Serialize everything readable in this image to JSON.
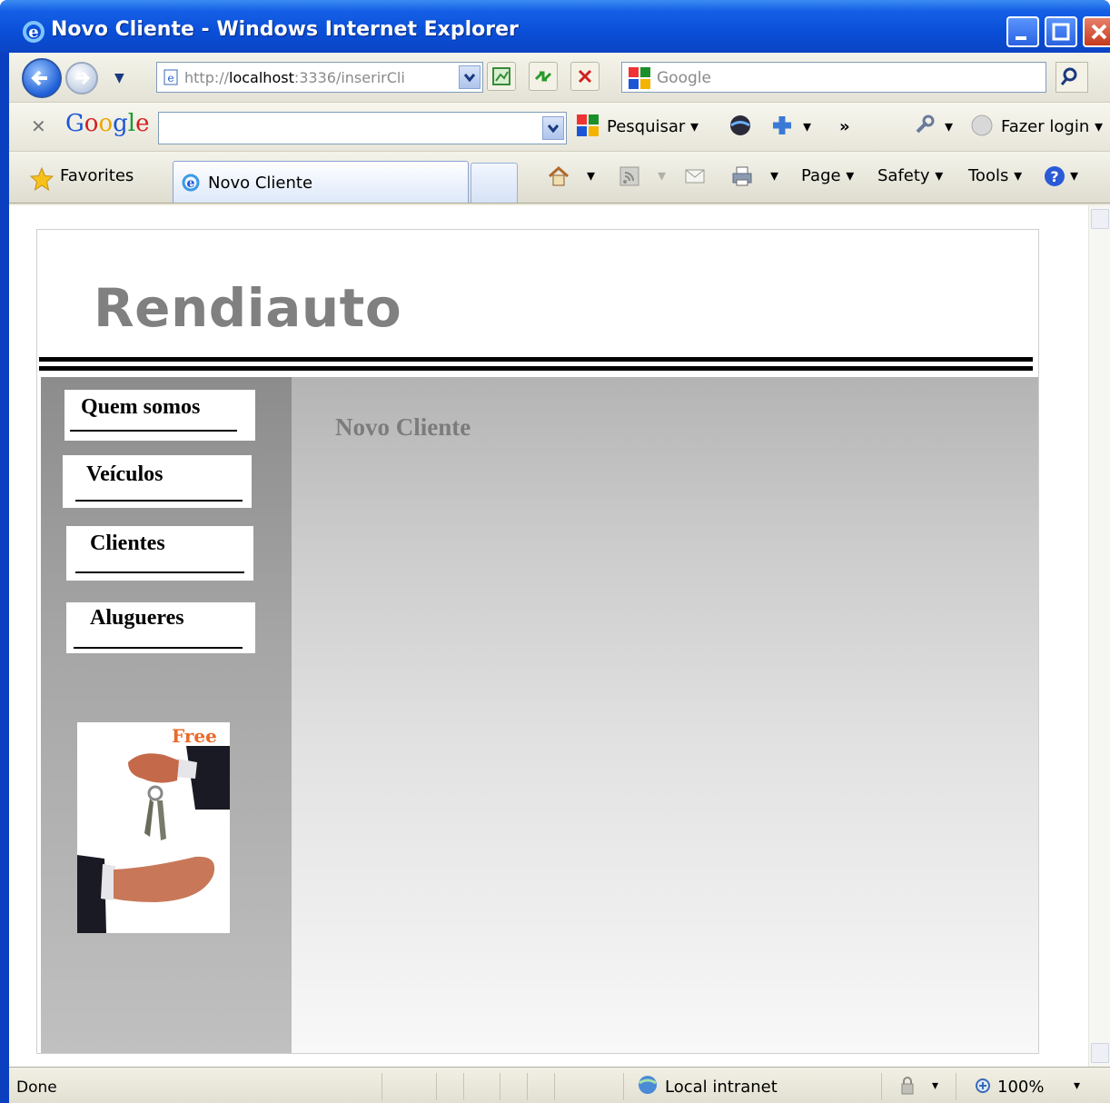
{
  "window": {
    "title": "Novo Cliente - Windows Internet Explorer"
  },
  "address_bar": {
    "url_prefix": "http://",
    "url_host": "localhost",
    "url_rest": ":3336/inserirCli",
    "search_placeholder": "Google"
  },
  "google_toolbar": {
    "logo_letters": [
      "G",
      "o",
      "o",
      "g",
      "l",
      "e"
    ],
    "search_label": "Pesquisar",
    "more": "»",
    "login_label": "Fazer login"
  },
  "favorites_bar": {
    "favorites_label": "Favorites",
    "tab_label": "Novo Cliente",
    "page_label": "Page",
    "safety_label": "Safety",
    "tools_label": "Tools"
  },
  "site": {
    "brand": "Rendiauto",
    "nav": [
      "Quem somos",
      "Veículos",
      "Clientes",
      "Alugueres"
    ],
    "promo_text": "Free",
    "page_heading": "Novo Cliente"
  },
  "status_bar": {
    "status": "Done",
    "zone": "Local intranet",
    "zoom": "100%"
  },
  "colors": {
    "title_blue": "#0a4fd8",
    "brand_gray": "#808080",
    "heading_gray": "#7c7c7c"
  },
  "icons": [
    "ie-logo-icon",
    "back-icon",
    "forward-icon",
    "refresh-icon",
    "stop-icon",
    "search-icon",
    "star-icon",
    "home-icon",
    "feeds-icon",
    "mail-icon",
    "print-icon",
    "help-icon",
    "wrench-icon",
    "globe-icon",
    "zoom-icon"
  ]
}
